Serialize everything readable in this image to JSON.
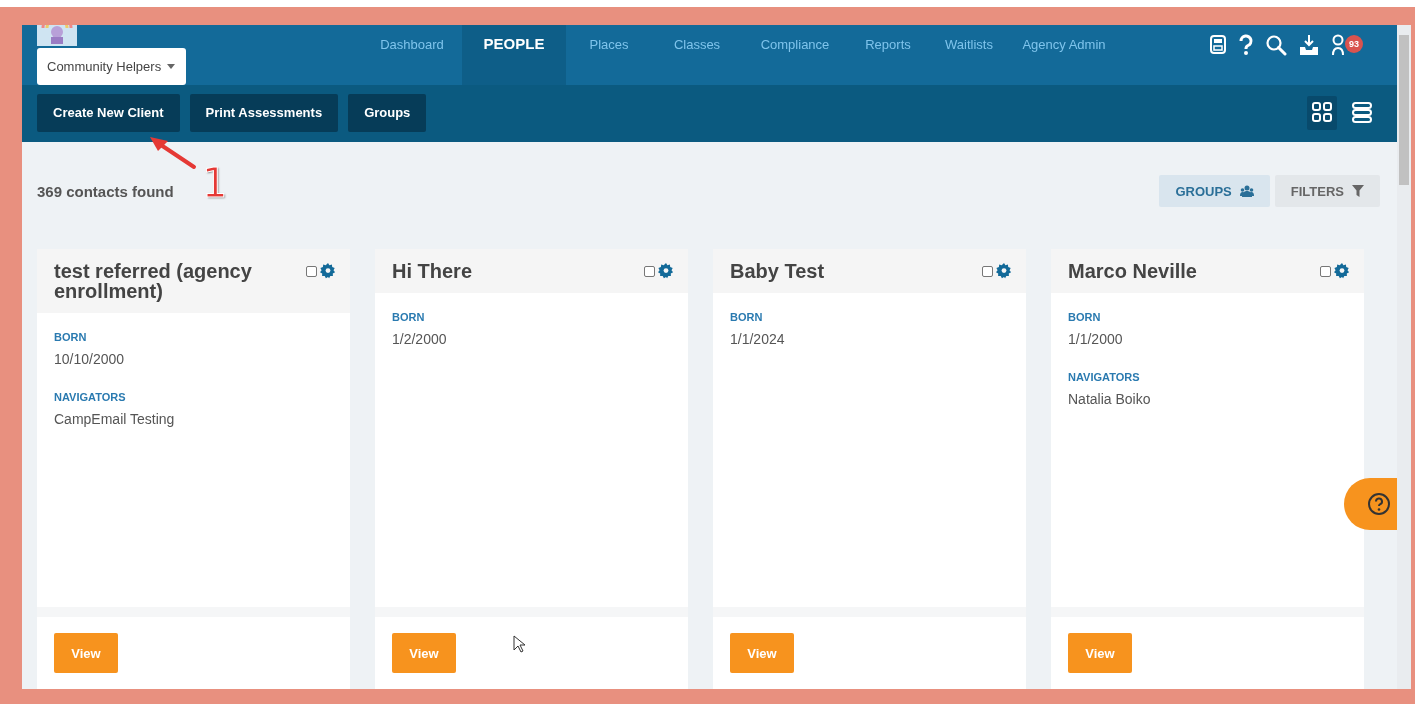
{
  "nav": {
    "org_select": "Community Helpers",
    "links": [
      {
        "label": "Dashboard",
        "selected": false
      },
      {
        "label": "PEOPLE",
        "selected": true
      },
      {
        "label": "Places",
        "selected": false
      },
      {
        "label": "Classes",
        "selected": false
      },
      {
        "label": "Compliance",
        "selected": false
      },
      {
        "label": "Reports",
        "selected": false
      },
      {
        "label": "Waitlists",
        "selected": false
      },
      {
        "label": "Agency Admin",
        "selected": false
      }
    ],
    "notification_count": "93"
  },
  "toolbar": {
    "buttons": [
      "Create New Client",
      "Print Assessments",
      "Groups"
    ],
    "views": [
      {
        "kind": "grid",
        "selected": true
      },
      {
        "kind": "list",
        "selected": false
      }
    ]
  },
  "results": {
    "count_text": "369 contacts found",
    "buttons": [
      {
        "kind": "groups",
        "label": "GROUPS"
      },
      {
        "kind": "filters",
        "label": "FILTERS"
      }
    ]
  },
  "cards": [
    {
      "name": "test referred (agency enrollment)",
      "checked": false,
      "fields": [
        {
          "label": "BORN",
          "value": "10/10/2000"
        },
        {
          "label": "NAVIGATORS",
          "value": "CampEmail Testing"
        }
      ],
      "action": "View"
    },
    {
      "name": "Hi There",
      "checked": false,
      "fields": [
        {
          "label": "BORN",
          "value": "1/2/2000"
        }
      ],
      "action": "View"
    },
    {
      "name": "Baby Test",
      "checked": false,
      "fields": [
        {
          "label": "BORN",
          "value": "1/1/2024"
        }
      ],
      "action": "View"
    },
    {
      "name": "Marco Neville",
      "checked": false,
      "fields": [
        {
          "label": "BORN",
          "value": "1/1/2000"
        },
        {
          "label": "NAVIGATORS",
          "value": "Natalia Boiko"
        }
      ],
      "action": "View"
    }
  ],
  "annotation": {
    "label": "1"
  }
}
